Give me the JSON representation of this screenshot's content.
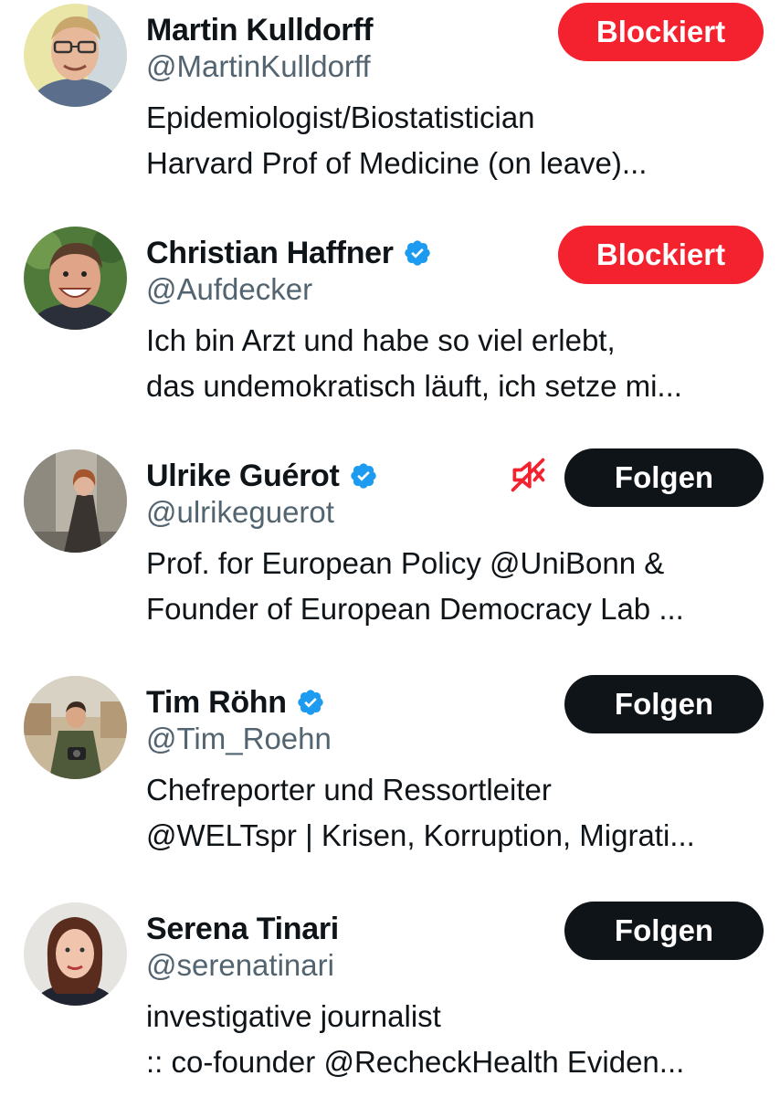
{
  "colors": {
    "blocked_button": "#f4212e",
    "follow_button": "#0f1419",
    "handle_text": "#536471",
    "verified_badge": "#1d9bf0",
    "muted_icon": "#f4212e"
  },
  "users": [
    {
      "name": "Martin Kulldorff",
      "handle": "@MartinKulldorff",
      "verified": false,
      "bio": [
        "Epidemiologist/Biostatistician",
        "Harvard Prof of Medicine (on leave)..."
      ],
      "action": "Blockiert",
      "muted": false
    },
    {
      "name": "Christian Haffner",
      "handle": "@Aufdecker",
      "verified": true,
      "bio": [
        "Ich bin Arzt und habe so viel erlebt,",
        "das undemokratisch läuft, ich setze mi..."
      ],
      "action": "Blockiert",
      "muted": false
    },
    {
      "name": "Ulrike Guérot",
      "handle": "@ulrikeguerot",
      "verified": true,
      "bio": [
        "Prof. for European Policy @UniBonn &",
        "Founder of European Democracy Lab ..."
      ],
      "action": "Folgen",
      "muted": true,
      "muted_icon": "muted-speaker-icon"
    },
    {
      "name": "Tim Röhn",
      "handle": "@Tim_Roehn",
      "verified": true,
      "bio": [
        "Chefreporter und Ressortleiter",
        "@WELTspr | Krisen, Korruption, Migrati..."
      ],
      "action": "Folgen",
      "muted": false
    },
    {
      "name": "Serena Tinari",
      "handle": "@serenatinari",
      "verified": false,
      "bio": [
        "investigative journalist",
        ":: co-founder @RecheckHealth Eviden..."
      ],
      "action": "Folgen",
      "muted": false
    }
  ]
}
